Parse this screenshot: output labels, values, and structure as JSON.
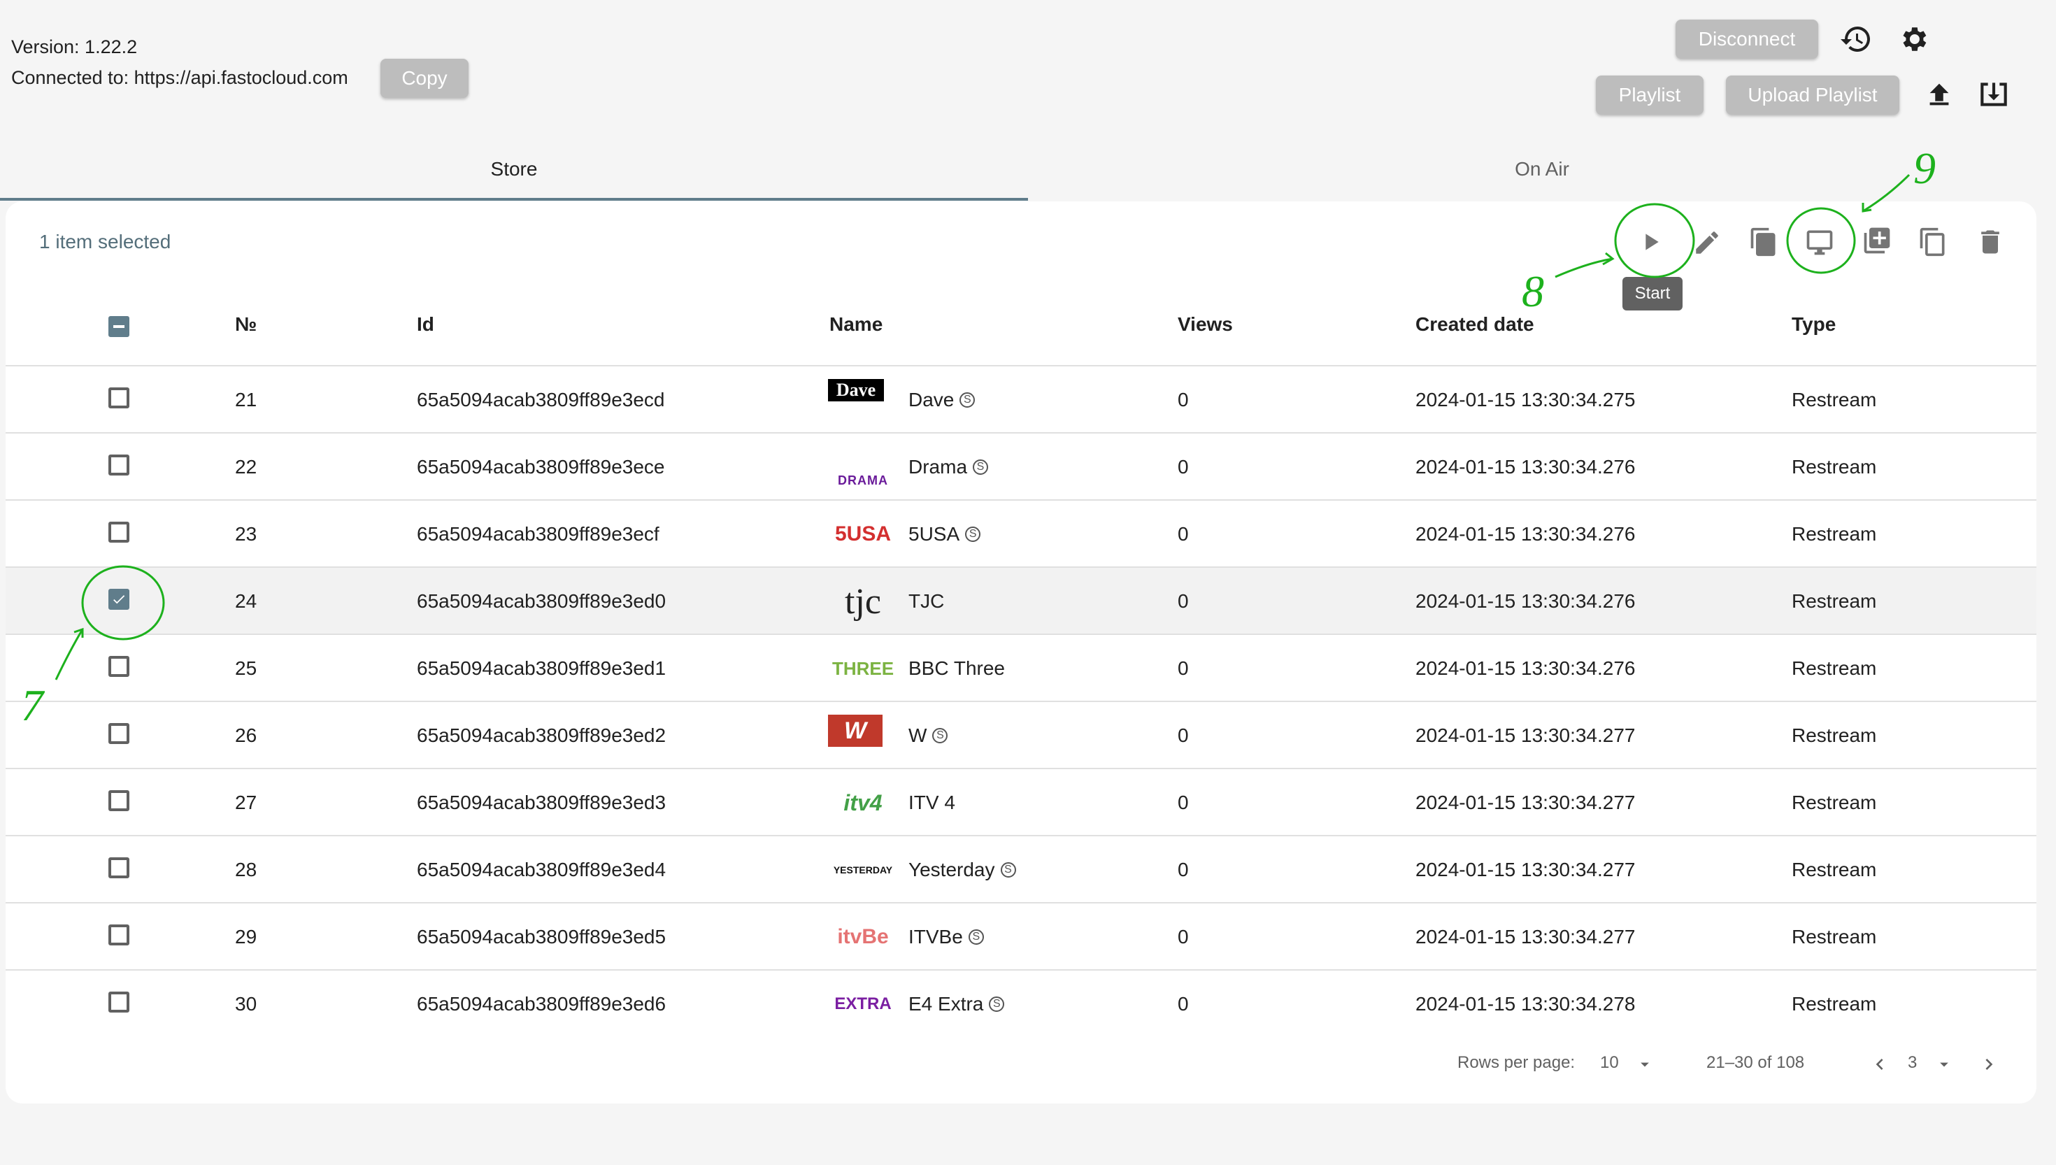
{
  "header": {
    "version": "Version: 1.22.2",
    "connected": "Connected to: https://api.fastocloud.com",
    "copy_label": "Copy",
    "disconnect_label": "Disconnect",
    "playlist_label": "Playlist",
    "upload_playlist_label": "Upload Playlist"
  },
  "tabs": [
    {
      "label": "Store",
      "active": true
    },
    {
      "label": "On Air",
      "active": false
    }
  ],
  "toolbar": {
    "selected_text": "1 item selected",
    "start_tooltip": "Start"
  },
  "table": {
    "columns": [
      "№",
      "Id",
      "Name",
      "Views",
      "Created date",
      "Type"
    ],
    "rows": [
      {
        "num": "21",
        "id": "65a5094acab3809ff89e3ecd",
        "name": "Dave",
        "service": true,
        "views": "0",
        "created": "2024-01-15 13:30:34.275",
        "type": "Restream",
        "logo": "Dave",
        "checked": false
      },
      {
        "num": "22",
        "id": "65a5094acab3809ff89e3ece",
        "name": "Drama",
        "service": true,
        "views": "0",
        "created": "2024-01-15 13:30:34.276",
        "type": "Restream",
        "logo": "DRAMA",
        "checked": false
      },
      {
        "num": "23",
        "id": "65a5094acab3809ff89e3ecf",
        "name": "5USA",
        "service": true,
        "views": "0",
        "created": "2024-01-15 13:30:34.276",
        "type": "Restream",
        "logo": "5USA",
        "checked": false
      },
      {
        "num": "24",
        "id": "65a5094acab3809ff89e3ed0",
        "name": "TJC",
        "service": false,
        "views": "0",
        "created": "2024-01-15 13:30:34.276",
        "type": "Restream",
        "logo": "tjc",
        "checked": true
      },
      {
        "num": "25",
        "id": "65a5094acab3809ff89e3ed1",
        "name": "BBC Three",
        "service": false,
        "views": "0",
        "created": "2024-01-15 13:30:34.276",
        "type": "Restream",
        "logo": "THREE",
        "checked": false
      },
      {
        "num": "26",
        "id": "65a5094acab3809ff89e3ed2",
        "name": "W",
        "service": true,
        "views": "0",
        "created": "2024-01-15 13:30:34.277",
        "type": "Restream",
        "logo": "W",
        "checked": false
      },
      {
        "num": "27",
        "id": "65a5094acab3809ff89e3ed3",
        "name": "ITV 4",
        "service": false,
        "views": "0",
        "created": "2024-01-15 13:30:34.277",
        "type": "Restream",
        "logo": "itv4",
        "checked": false
      },
      {
        "num": "28",
        "id": "65a5094acab3809ff89e3ed4",
        "name": "Yesterday",
        "service": true,
        "views": "0",
        "created": "2024-01-15 13:30:34.277",
        "type": "Restream",
        "logo": "YESTERDAY",
        "checked": false
      },
      {
        "num": "29",
        "id": "65a5094acab3809ff89e3ed5",
        "name": "ITVBe",
        "service": true,
        "views": "0",
        "created": "2024-01-15 13:30:34.277",
        "type": "Restream",
        "logo": "itvBe",
        "checked": false
      },
      {
        "num": "30",
        "id": "65a5094acab3809ff89e3ed6",
        "name": "E4 Extra",
        "service": true,
        "views": "0",
        "created": "2024-01-15 13:30:34.278",
        "type": "Restream",
        "logo": "EXTRA",
        "checked": false
      }
    ]
  },
  "pagination": {
    "rows_per_page_label": "Rows per page:",
    "rows_per_page": "10",
    "range": "21–30 of 108",
    "page": "3"
  },
  "annotations": [
    "7",
    "8",
    "9"
  ],
  "service_glyph": "S",
  "colors": {
    "accent": "#607d8b",
    "annotation": "#1db11d",
    "button": "#bdbdbd"
  }
}
